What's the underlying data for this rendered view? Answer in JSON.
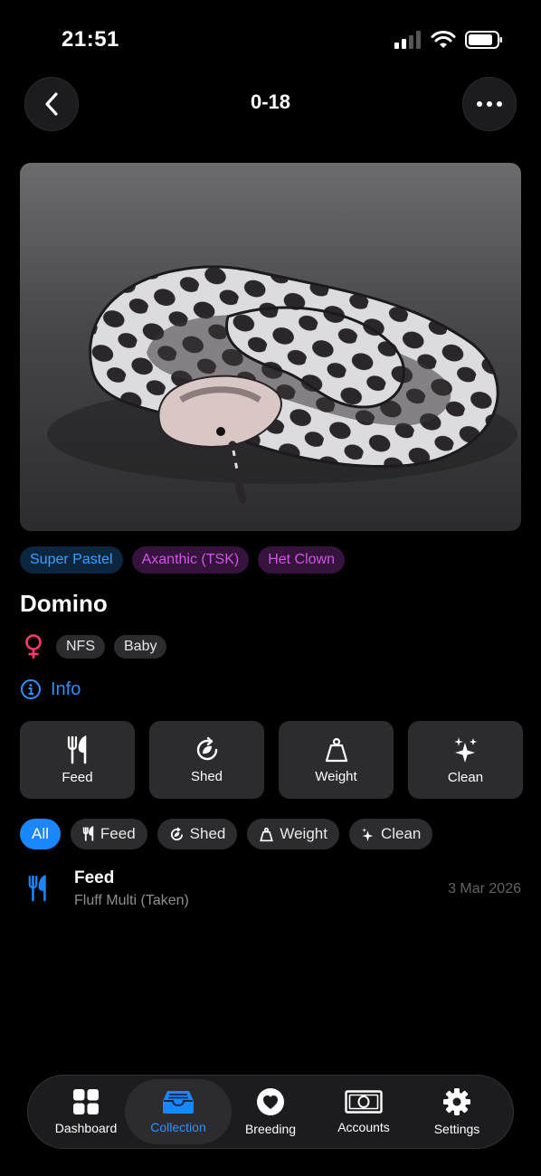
{
  "status": {
    "time": "21:51"
  },
  "nav": {
    "title": "0-18"
  },
  "morphs": [
    {
      "label": "Super Pastel",
      "color": "#3aa0ff"
    },
    {
      "label": "Axanthic (TSK)",
      "color": "#d155e6"
    },
    {
      "label": "Het Clown",
      "color": "#d155e6"
    }
  ],
  "animal": {
    "name": "Domino",
    "sex_icon": "female-icon",
    "tags": [
      "NFS",
      "Baby"
    ]
  },
  "info_label": "Info",
  "actions": [
    {
      "label": "Feed",
      "icon": "fork-knife-icon"
    },
    {
      "label": "Shed",
      "icon": "shed-icon"
    },
    {
      "label": "Weight",
      "icon": "weight-icon"
    },
    {
      "label": "Clean",
      "icon": "sparkles-icon"
    }
  ],
  "filters": [
    {
      "label": "All",
      "active": true
    },
    {
      "label": "Feed",
      "icon": "fork-knife-icon"
    },
    {
      "label": "Shed",
      "icon": "shed-icon"
    },
    {
      "label": "Weight",
      "icon": "weight-icon"
    },
    {
      "label": "Clean",
      "icon": "sparkles-icon"
    }
  ],
  "log": [
    {
      "title": "Feed",
      "subtitle": "Fluff Multi (Taken)",
      "date": "3 Mar 2026",
      "icon": "fork-knife-icon"
    }
  ],
  "tabbar": [
    {
      "label": "Dashboard",
      "icon": "dashboard-icon"
    },
    {
      "label": "Collection",
      "icon": "collection-icon",
      "active": true
    },
    {
      "label": "Breeding",
      "icon": "heart-icon"
    },
    {
      "label": "Accounts",
      "icon": "banknote-icon"
    },
    {
      "label": "Settings",
      "icon": "gear-icon"
    }
  ],
  "colors": {
    "accent": "#1a86ff",
    "female": "#ff3b6b",
    "background": "#000000"
  }
}
